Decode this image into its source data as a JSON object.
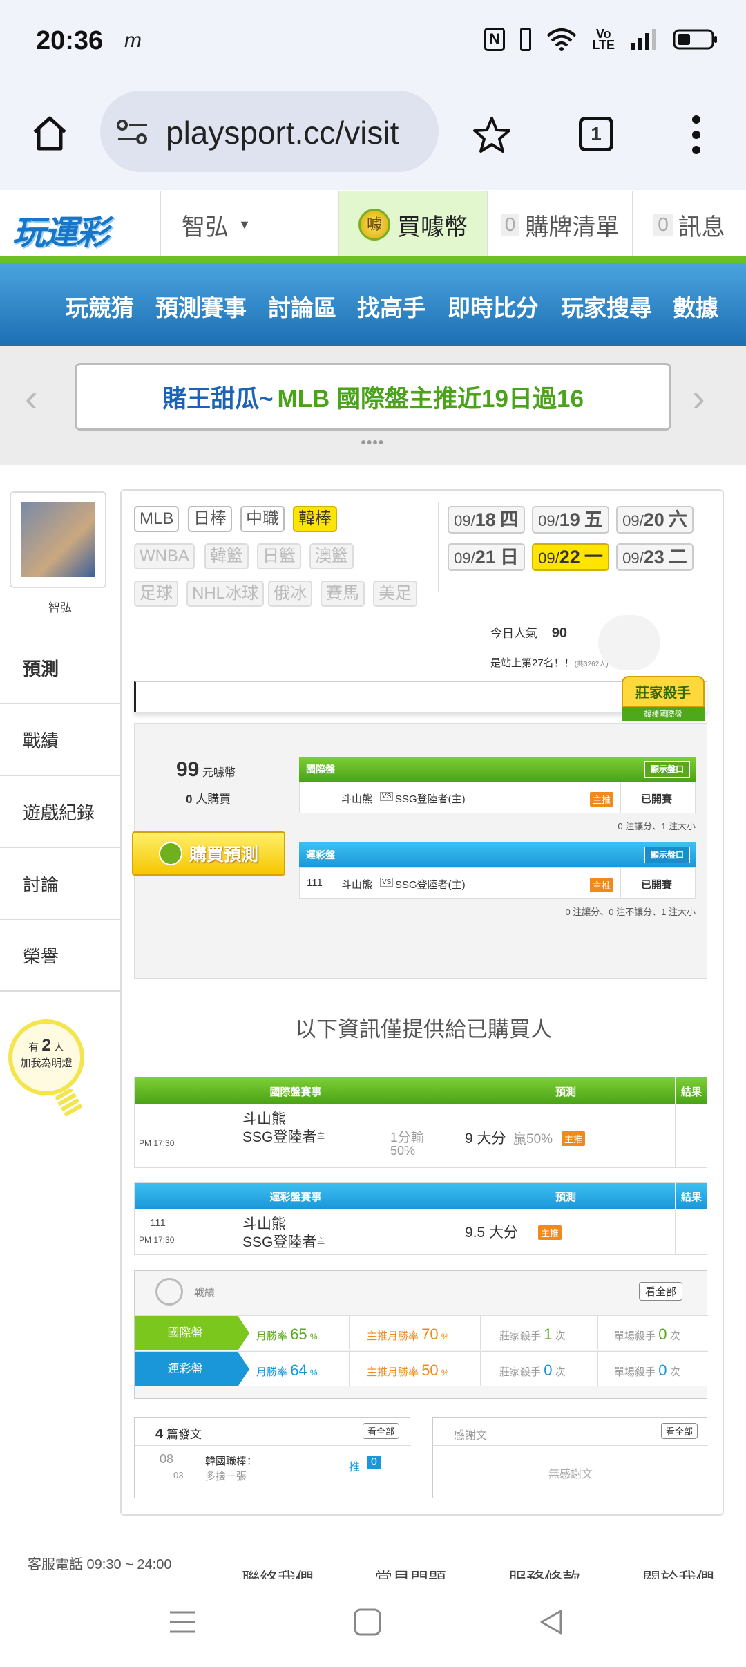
{
  "status_bar": {
    "time": "20:36",
    "carrier_glyph": "m",
    "icons": [
      "nfc-icon",
      "vibrate-icon",
      "wifi-icon",
      "volte-icon",
      "signal-icon",
      "battery-icon"
    ]
  },
  "browser": {
    "url": "playsport.cc/visit",
    "tab_count": "1"
  },
  "site_header": {
    "logo": "玩運彩",
    "username": "智弘",
    "buy_coins": "買噱幣",
    "cart_count": "0",
    "cart_label": "購牌清單",
    "msg_count": "0",
    "msg_label": "訊息",
    "coin_badge": "噱"
  },
  "nav": [
    "玩競猜",
    "預測賽事",
    "討論區",
    "找高手",
    "即時比分",
    "玩家搜尋",
    "數據"
  ],
  "banner": {
    "prefix": "賭王甜瓜~ ",
    "text": "MLB 國際盤主推近19日過16"
  },
  "sidebar": {
    "username": "智弘",
    "items": [
      "預測",
      "戰績",
      "遊戲紀錄",
      "討論",
      "榮譽"
    ],
    "fans": {
      "pre": "有",
      "count": "2",
      "post": "人",
      "line2": "加我為明燈"
    }
  },
  "leagues": {
    "row1": [
      "MLB",
      "日棒",
      "中職",
      "韓棒"
    ],
    "row2": [
      "WNBA",
      "韓籃",
      "日籃",
      "澳籃"
    ],
    "row3": [
      "足球",
      "NHL冰球",
      "俄冰",
      "賽馬",
      "美足"
    ],
    "selected": "韓棒"
  },
  "dates": [
    {
      "pre": "09/",
      "day": "18",
      "wd": "四"
    },
    {
      "pre": "09/",
      "day": "19",
      "wd": "五"
    },
    {
      "pre": "09/",
      "day": "20",
      "wd": "六"
    },
    {
      "pre": "09/",
      "day": "21",
      "wd": "日"
    },
    {
      "pre": "09/",
      "day": "22",
      "wd": "一"
    },
    {
      "pre": "09/",
      "day": "23",
      "wd": "二"
    }
  ],
  "popularity": {
    "label": "今日人氣",
    "value": "90",
    "rank": "是站上第27名！！",
    "rank_note": "(共3262人)"
  },
  "killer_badge": {
    "title": "莊家殺手",
    "sub": "韓棒國際盤"
  },
  "purchase": {
    "price": "99",
    "price_unit": "元噱幣",
    "buyers": "0",
    "buyers_unit": "人購買",
    "buy_button": "購買預測"
  },
  "intl_table": {
    "header": "國際盤",
    "show_btn": "顯示盤口",
    "away": "斗山熊",
    "vs": "VS",
    "home": "SSG登陸者(主)",
    "host_tag": "主推",
    "status": "已開賽",
    "note": "0 注讓分、1 注大小"
  },
  "lottery_table": {
    "header": "運彩盤",
    "show_btn": "顯示盤口",
    "game_no": "111",
    "away": "斗山熊",
    "vs": "VS",
    "home": "SSG登陸者(主)",
    "host_tag": "主推",
    "status": "已開賽",
    "note": "0 注讓分、0 注不讓分、1 注大小"
  },
  "info_notice": "以下資訊僅提供給已購買人",
  "intl_results": {
    "col_game": "國際盤賽事",
    "col_pred": "預測",
    "col_result": "結果",
    "time": "PM 17:30",
    "away": "斗山熊",
    "home": "SSG登陸者",
    "home_tag": "主",
    "line": "1分輸",
    "line_pct": "50%",
    "pick": "9 大分",
    "pick_extra": "贏50%",
    "pick_tag": "主推"
  },
  "lottery_results": {
    "col_game": "運彩盤賽事",
    "col_pred": "預測",
    "col_result": "結果",
    "game_no": "111",
    "time": "PM 17:30",
    "away": "斗山熊",
    "home": "SSG登陸者",
    "home_tag": "主",
    "pick": "9.5 大分",
    "pick_tag": "主推"
  },
  "record": {
    "title": "戰績",
    "view_all": "看全部",
    "rows": [
      {
        "name": "國際盤",
        "rate_label": "月勝率",
        "rate": "65",
        "main_label": "主推月勝率",
        "main": "70",
        "killer_label": "莊家殺手",
        "killer": "1",
        "single_label": "單場殺手",
        "single": "0",
        "pct": "%",
        "unit": "次"
      },
      {
        "name": "運彩盤",
        "rate_label": "月勝率",
        "rate": "64",
        "main_label": "主推月勝率",
        "main": "50",
        "killer_label": "莊家殺手",
        "killer": "0",
        "single_label": "單場殺手",
        "single": "0",
        "pct": "%",
        "unit": "次"
      }
    ]
  },
  "posts": {
    "count": "4",
    "label": "篇發文",
    "view_all": "看全部",
    "month": "08",
    "day": "03",
    "title": "韓國職棒：",
    "subtitle": "多撿一張",
    "push": "推",
    "push_count": "0"
  },
  "thanks": {
    "label": "感謝文",
    "view_all": "看全部",
    "empty": "無感謝文"
  },
  "footer": {
    "phone": "客服電話 09:30 ~ 24:00",
    "links": [
      "聯絡我們",
      "常見問題",
      "服務條款",
      "關於我們"
    ]
  },
  "colors": {
    "green": "#6cbe2a",
    "blue": "#1d8fd6",
    "yellow": "#ffe400",
    "orange": "#f08a1c"
  }
}
